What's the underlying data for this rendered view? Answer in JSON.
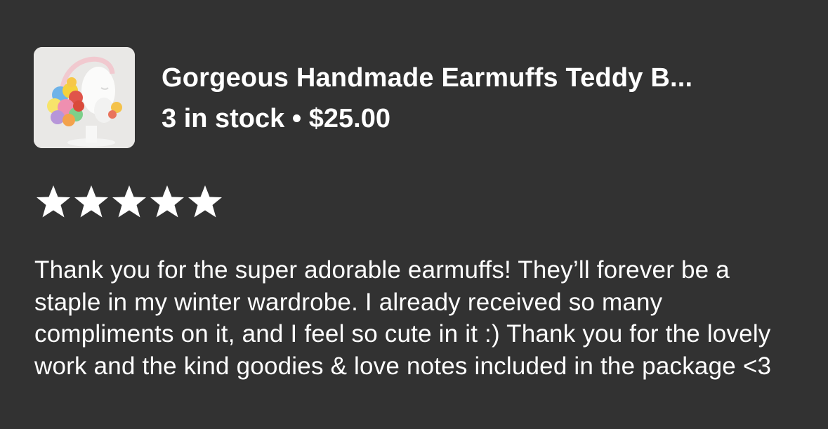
{
  "listing": {
    "title": "Gorgeous Handmade Earmuffs Teddy B...",
    "stock": "3 in stock",
    "separator": "•",
    "price": "$25.00",
    "thumbnail_icon": "earmuffs-product-photo"
  },
  "review": {
    "rating": 5,
    "max_rating": 5,
    "text": "Thank you for the super adorable earmuffs! They’ll forever be a staple in my winter wardrobe. I already received so many compliments on it, and I feel so cute in it :) Thank you for the lovely work and the kind goodies & love notes included in the package <3"
  },
  "colors": {
    "background": "#323232",
    "text": "#ffffff",
    "thumbnail_bg": "#e9e8e6"
  }
}
